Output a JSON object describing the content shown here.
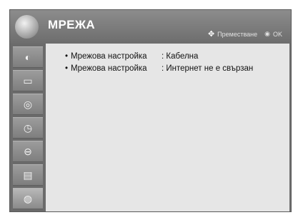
{
  "header": {
    "title": "МРЕЖА",
    "hint_move": "Преместване",
    "hint_ok": "OK"
  },
  "sidebar": {
    "items": [
      {
        "icon": "image-icon"
      },
      {
        "icon": "monitor-icon"
      },
      {
        "icon": "audio-icon"
      },
      {
        "icon": "clock-icon"
      },
      {
        "icon": "lock-icon"
      },
      {
        "icon": "options-icon"
      },
      {
        "icon": "network-icon",
        "active": true
      }
    ]
  },
  "content": {
    "rows": [
      {
        "bullet": "•",
        "label": "Мрежова настройка",
        "value": ": Кабелна"
      },
      {
        "bullet": "•",
        "label": "Мрежова настройка",
        "value": ": Интернет не е свързан"
      }
    ]
  },
  "colors": {
    "frame": "#6e6e6e",
    "content_bg": "#e6e6e6",
    "title_text": "#ffffff"
  }
}
